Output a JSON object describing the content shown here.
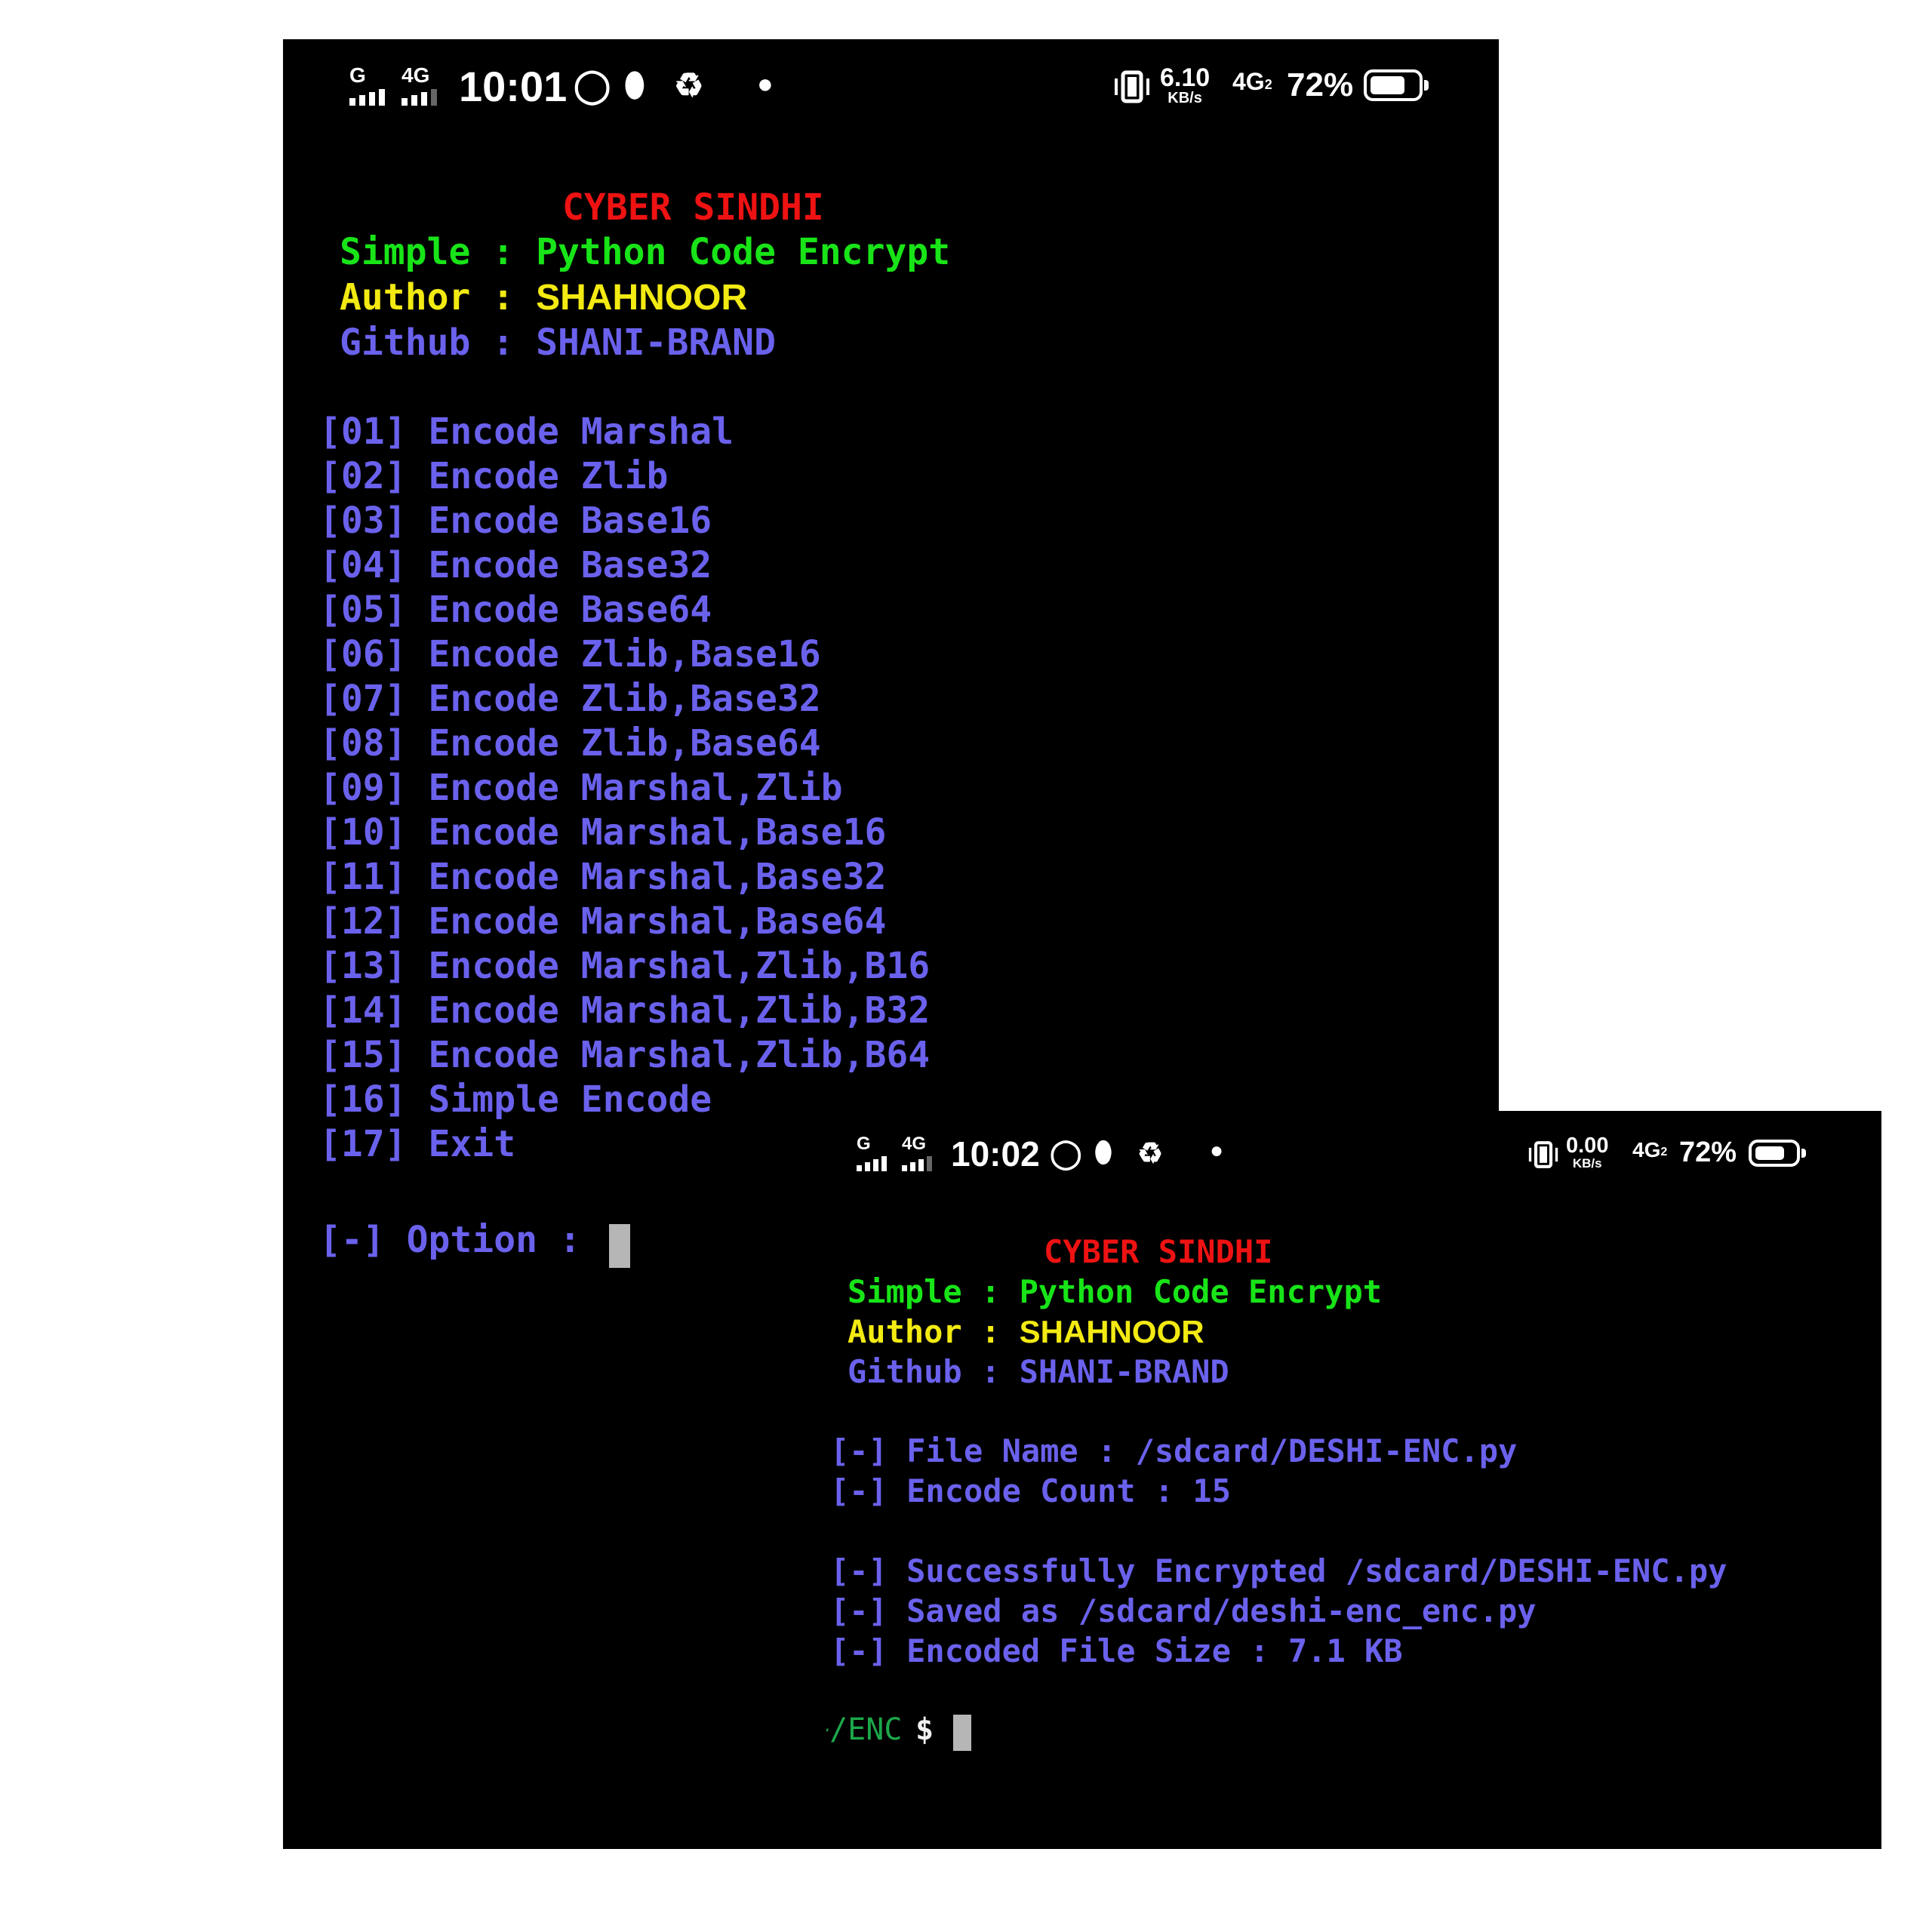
{
  "screen1": {
    "status": {
      "signal1_label": "G",
      "signal2_label": "4G",
      "time": "10:01",
      "speed_value": "6.10",
      "speed_unit": "KB/s",
      "network": "4G",
      "network_sub": "2",
      "battery": "72%",
      "battery_level": 0.72,
      "notification_icons": [
        "whatsapp-icon",
        "leaf-icon",
        "recycle-icon"
      ]
    },
    "banner": {
      "title": "CYBER SINDHI",
      "simple_line": "Simple : Python Code Encrypt",
      "author_key": "Author : ",
      "author_value": "SHAHNOOR",
      "github_line": "Github : SHANI-BRAND"
    },
    "menu": [
      "[01] Encode Marshal",
      "[02] Encode Zlib",
      "[03] Encode Base16",
      "[04] Encode Base32",
      "[05] Encode Base64",
      "[06] Encode Zlib,Base16",
      "[07] Encode Zlib,Base32",
      "[08] Encode Zlib,Base64",
      "[09] Encode Marshal,Zlib",
      "[10] Encode Marshal,Base16",
      "[11] Encode Marshal,Base32",
      "[12] Encode Marshal,Base64",
      "[13] Encode Marshal,Zlib,B16",
      "[14] Encode Marshal,Zlib,B32",
      "[15] Encode Marshal,Zlib,B64",
      "[16] Simple Encode",
      "[17] Exit"
    ],
    "prompt": "[-] Option : "
  },
  "screen2": {
    "status": {
      "signal1_label": "G",
      "signal2_label": "4G",
      "time": "10:02",
      "speed_value": "0.00",
      "speed_unit": "KB/s",
      "network": "4G",
      "network_sub": "2",
      "battery": "72%",
      "battery_level": 0.72,
      "notification_icons": [
        "whatsapp-icon",
        "leaf-icon",
        "recycle-icon"
      ]
    },
    "banner": {
      "title": "CYBER SINDHI",
      "simple_line": "Simple : Python Code Encrypt",
      "author_key": "Author : ",
      "author_value": "SHAHNOOR",
      "github_line": "Github : SHANI-BRAND"
    },
    "output": [
      "[-] File Name : /sdcard/DESHI-ENC.py",
      "[-] Encode Count : 15",
      "[-] Successfully Encrypted /sdcard/DESHI-ENC.py",
      "[-] Saved as /sdcard/deshi-enc_enc.py",
      "[-] Encoded File Size : 7.1 KB"
    ],
    "shell_path": "~/ENC",
    "shell_prompt": "$"
  },
  "colors": {
    "title": "#ee1212",
    "simple": "#18e418",
    "author": "#f2ea12",
    "text": "#6a61ec",
    "path": "#1ca84a"
  }
}
